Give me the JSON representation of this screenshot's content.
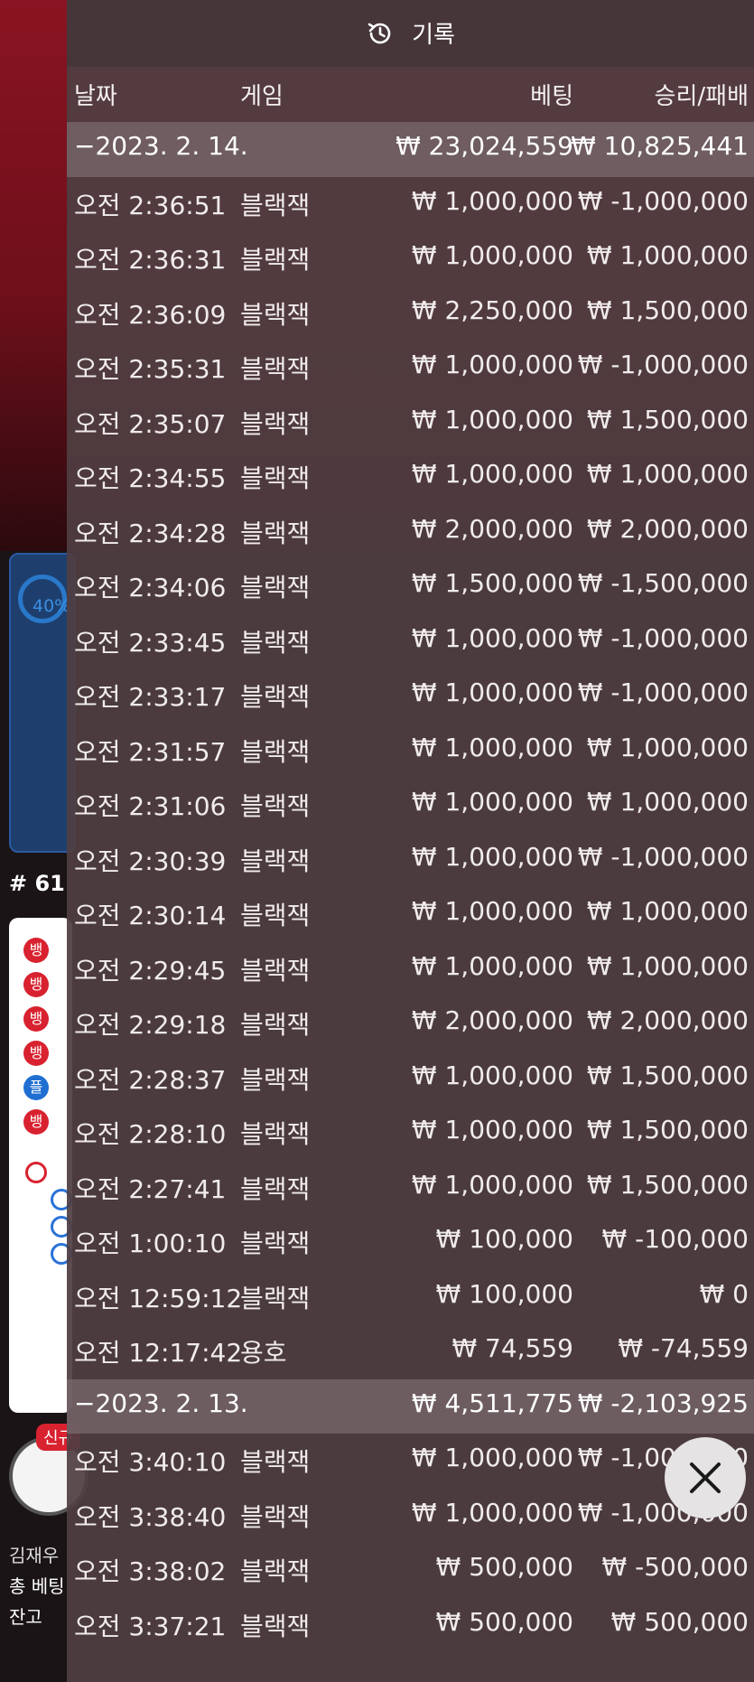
{
  "header": {
    "title": "기록",
    "icon": "history-icon"
  },
  "columns": {
    "date": "날짜",
    "game": "게임",
    "bet": "베팅",
    "winloss": "승리/패배"
  },
  "rows": [
    {
      "type": "date",
      "label": "−2023. 2. 14.",
      "bet": "₩ 23,024,559",
      "winloss": "₩ 10,825,441"
    },
    {
      "type": "item",
      "time": "오전 2:36:51",
      "game": "블랙잭",
      "bet": "₩ 1,000,000",
      "winloss": "₩ -1,000,000"
    },
    {
      "type": "item",
      "time": "오전 2:36:31",
      "game": "블랙잭",
      "bet": "₩ 1,000,000",
      "winloss": "₩ 1,000,000"
    },
    {
      "type": "item",
      "time": "오전 2:36:09",
      "game": "블랙잭",
      "bet": "₩ 2,250,000",
      "winloss": "₩ 1,500,000"
    },
    {
      "type": "item",
      "time": "오전 2:35:31",
      "game": "블랙잭",
      "bet": "₩ 1,000,000",
      "winloss": "₩ -1,000,000"
    },
    {
      "type": "item",
      "time": "오전 2:35:07",
      "game": "블랙잭",
      "bet": "₩ 1,000,000",
      "winloss": "₩ 1,500,000"
    },
    {
      "type": "item",
      "time": "오전 2:34:55",
      "game": "블랙잭",
      "bet": "₩ 1,000,000",
      "winloss": "₩ 1,000,000"
    },
    {
      "type": "item",
      "time": "오전 2:34:28",
      "game": "블랙잭",
      "bet": "₩ 2,000,000",
      "winloss": "₩ 2,000,000"
    },
    {
      "type": "item",
      "time": "오전 2:34:06",
      "game": "블랙잭",
      "bet": "₩ 1,500,000",
      "winloss": "₩ -1,500,000"
    },
    {
      "type": "item",
      "time": "오전 2:33:45",
      "game": "블랙잭",
      "bet": "₩ 1,000,000",
      "winloss": "₩ -1,000,000"
    },
    {
      "type": "item",
      "time": "오전 2:33:17",
      "game": "블랙잭",
      "bet": "₩ 1,000,000",
      "winloss": "₩ -1,000,000"
    },
    {
      "type": "item",
      "time": "오전 2:31:57",
      "game": "블랙잭",
      "bet": "₩ 1,000,000",
      "winloss": "₩ 1,000,000"
    },
    {
      "type": "item",
      "time": "오전 2:31:06",
      "game": "블랙잭",
      "bet": "₩ 1,000,000",
      "winloss": "₩ 1,000,000"
    },
    {
      "type": "item",
      "time": "오전 2:30:39",
      "game": "블랙잭",
      "bet": "₩ 1,000,000",
      "winloss": "₩ -1,000,000"
    },
    {
      "type": "item",
      "time": "오전 2:30:14",
      "game": "블랙잭",
      "bet": "₩ 1,000,000",
      "winloss": "₩ 1,000,000"
    },
    {
      "type": "item",
      "time": "오전 2:29:45",
      "game": "블랙잭",
      "bet": "₩ 1,000,000",
      "winloss": "₩ 1,000,000"
    },
    {
      "type": "item",
      "time": "오전 2:29:18",
      "game": "블랙잭",
      "bet": "₩ 2,000,000",
      "winloss": "₩ 2,000,000"
    },
    {
      "type": "item",
      "time": "오전 2:28:37",
      "game": "블랙잭",
      "bet": "₩ 1,000,000",
      "winloss": "₩ 1,500,000"
    },
    {
      "type": "item",
      "time": "오전 2:28:10",
      "game": "블랙잭",
      "bet": "₩ 1,000,000",
      "winloss": "₩ 1,500,000"
    },
    {
      "type": "item",
      "time": "오전 2:27:41",
      "game": "블랙잭",
      "bet": "₩ 1,000,000",
      "winloss": "₩ 1,500,000"
    },
    {
      "type": "item",
      "time": "오전 1:00:10",
      "game": "블랙잭",
      "bet": "₩ 100,000",
      "winloss": "₩ -100,000"
    },
    {
      "type": "item",
      "time": "오전 12:59:12",
      "game": "블랙잭",
      "bet": "₩ 100,000",
      "winloss": "₩ 0"
    },
    {
      "type": "item",
      "time": "오전 12:17:42",
      "game": "용호",
      "bet": "₩ 74,559",
      "winloss": "₩ -74,559"
    },
    {
      "type": "date",
      "label": "−2023. 2. 13.",
      "bet": "₩ 4,511,775",
      "winloss": "₩ -2,103,925"
    },
    {
      "type": "item",
      "time": "오전 3:40:10",
      "game": "블랙잭",
      "bet": "₩ 1,000,000",
      "winloss": "₩ -1,000,000"
    },
    {
      "type": "item",
      "time": "오전 3:38:40",
      "game": "블랙잭",
      "bet": "₩ 1,000,000",
      "winloss": "₩ -1,000,000"
    },
    {
      "type": "item",
      "time": "오전 3:38:02",
      "game": "블랙잭",
      "bet": "₩ 500,000",
      "winloss": "₩ -500,000"
    },
    {
      "type": "item",
      "time": "오전 3:37:21",
      "game": "블랙잭",
      "bet": "₩ 500,000",
      "winloss": "₩ 500,000"
    }
  ],
  "close_button": {
    "icon": "close-icon"
  },
  "background": {
    "percent": "40%",
    "game_number": "# 61",
    "new_badge": "신규",
    "player_name": "김재우",
    "total_bet_label": "총 베팅",
    "balance_label": "잔고",
    "bead_labels": [
      "뱅",
      "뱅",
      "뱅",
      "뱅",
      "플",
      "뱅"
    ]
  }
}
